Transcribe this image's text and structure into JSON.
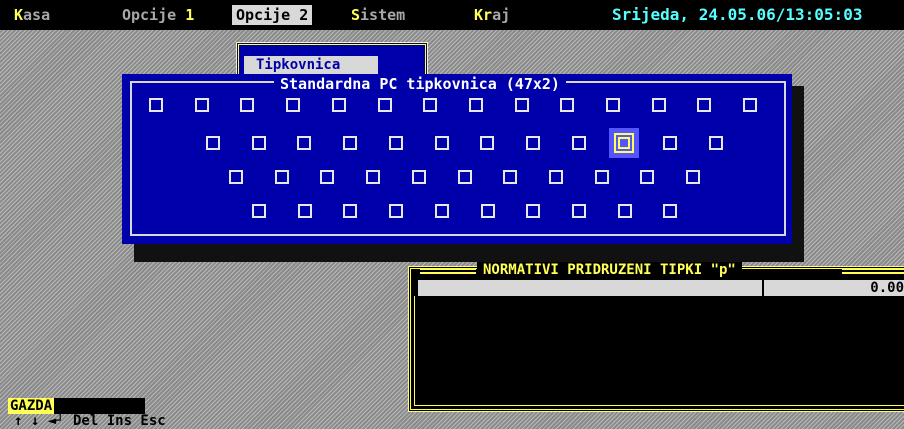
{
  "menubar": {
    "items": [
      {
        "hot": "K",
        "rest": "asa",
        "active": false
      },
      {
        "pre": "Opcije ",
        "hot": "1",
        "rest": "",
        "active": false
      },
      {
        "pre": "Opcije 2",
        "hot": "",
        "rest": "",
        "active": true
      },
      {
        "hot": "S",
        "rest": "istem",
        "active": false
      },
      {
        "hot": "Kr",
        "rest": "aj",
        "active": false
      }
    ],
    "datetime": "Srijeda, 24.05.06/13:05:03"
  },
  "submenu": {
    "item_label": "Tipkovnica",
    "arrow": "▸"
  },
  "keyboard_window": {
    "title": "Standardna PC tipkovnica (47x2)",
    "rows": [
      14,
      12,
      11,
      10
    ],
    "selected": {
      "row": 1,
      "col": 9
    }
  },
  "normativi_window": {
    "title": "NORMATIVI PRIDRUZENI TIPKI \"p\"",
    "value": "0.00"
  },
  "status": {
    "user": "GAZDA",
    "hints": "↑ ↓ ◄┘ Del Ins Esc"
  },
  "colors": {
    "window_blue": "#0000aa",
    "highlight_yellow": "#ffff55",
    "datetime_cyan": "#55ffff",
    "selected_key": "#5555ff"
  }
}
